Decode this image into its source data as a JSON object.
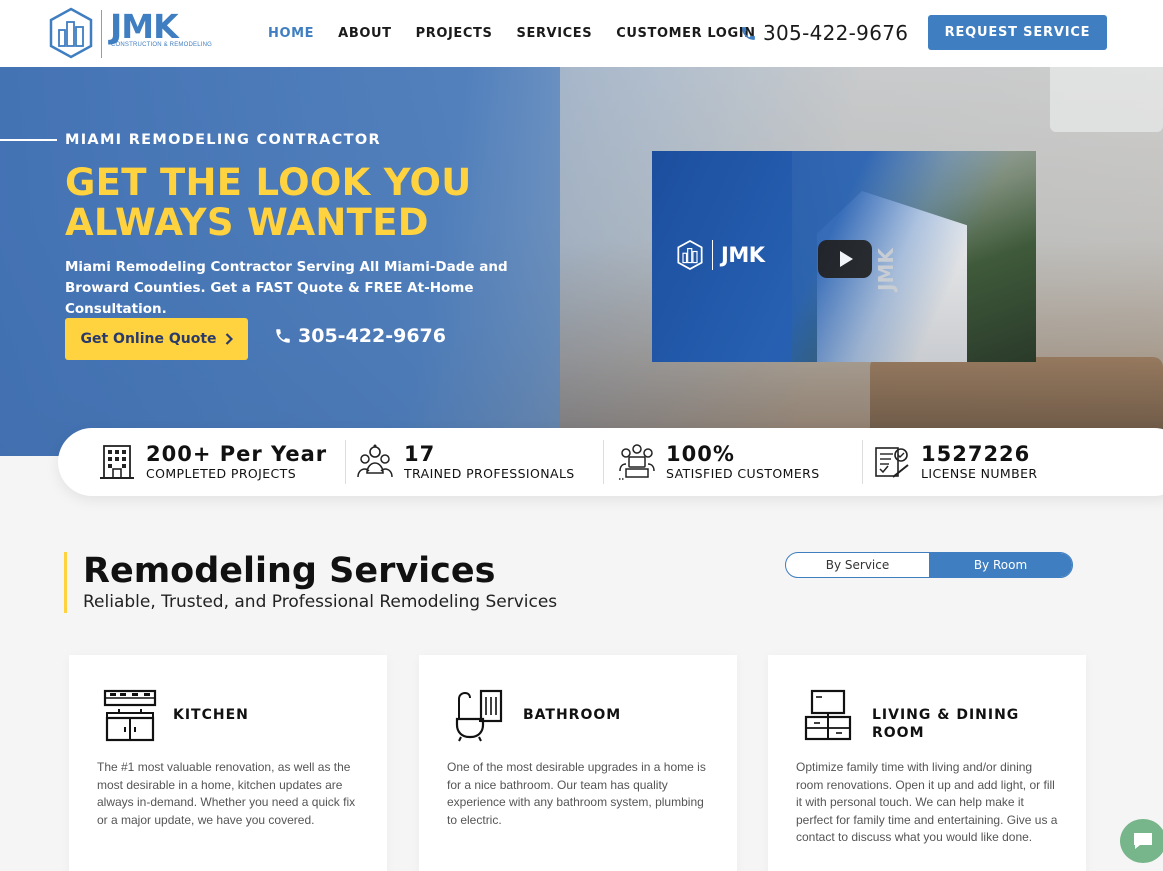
{
  "brand": {
    "name": "JMK",
    "tagline": "CONSTRUCTION & REMODELING",
    "accent": "#3f7ec1",
    "highlight": "#ffd23f"
  },
  "nav": {
    "items": [
      {
        "label": "HOME",
        "active": true
      },
      {
        "label": "ABOUT",
        "active": false
      },
      {
        "label": "PROJECTS",
        "active": false
      },
      {
        "label": "SERVICES",
        "active": false
      },
      {
        "label": "CUSTOMER LOGIN",
        "active": false
      }
    ],
    "phone": "305-422-9676",
    "cta": "REQUEST SERVICE"
  },
  "hero": {
    "eyebrow": "MIAMI REMODELING CONTRACTOR",
    "title": "GET THE LOOK YOU ALWAYS WANTED",
    "description": "Miami Remodeling Contractor Serving All Miami-Dade and Broward Counties. Get a FAST Quote & FREE At-Home Consultation.",
    "quote_button": "Get Online Quote",
    "phone": "305-422-9676",
    "video": {
      "logo_text": "JMK",
      "side_text": "JMK"
    }
  },
  "stats": [
    {
      "value": "200+ Per Year",
      "label": "COMPLETED PROJECTS",
      "icon": "building-icon"
    },
    {
      "value": "17",
      "label": "TRAINED PROFESSIONALS",
      "icon": "team-icon"
    },
    {
      "value": "100%",
      "label": "SATISFIED CUSTOMERS",
      "icon": "customers-icon"
    },
    {
      "value": "1527226",
      "label": "LICENSE NUMBER",
      "icon": "license-icon"
    }
  ],
  "services": {
    "title": "Remodeling Services",
    "subtitle": "Reliable, Trusted, and Professional Remodeling Services",
    "toggle": [
      {
        "label": "By Service",
        "active": false
      },
      {
        "label": "By Room",
        "active": true
      }
    ],
    "cards": [
      {
        "title": "KITCHEN",
        "icon": "kitchen-icon",
        "text": "The #1 most valuable renovation, as well as the most desirable in a home, kitchen updates are always in-demand. Whether you need a quick fix or a major update, we have you covered."
      },
      {
        "title": "BATHROOM",
        "icon": "bathroom-icon",
        "text": "One of the most desirable upgrades in a home is for a nice bathroom. Our team has quality experience with any bathroom system, plumbing to electric."
      },
      {
        "title": "LIVING & DINING ROOM",
        "icon": "living-room-icon",
        "text": "Optimize family time with living and/or dining room renovations. Open it up and add light, or fill it with personal touch. We can help make it perfect for family time and entertaining. Give us a contact to discuss what you would like done."
      }
    ]
  }
}
